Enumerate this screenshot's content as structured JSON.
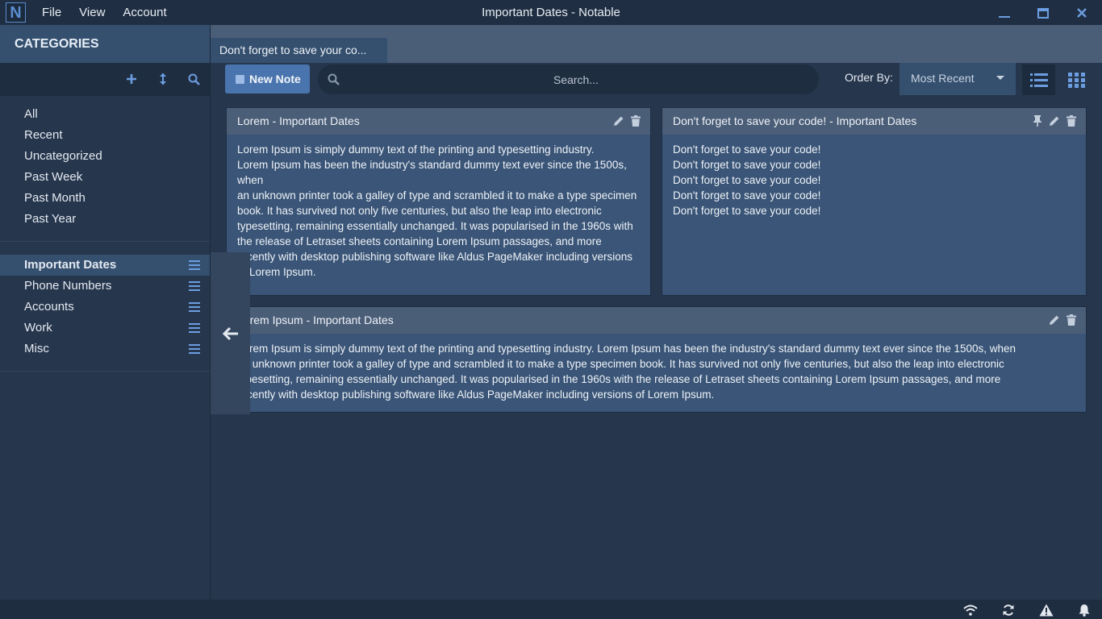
{
  "app": {
    "window_title": "Important Dates - Notable",
    "logo_letter": "N",
    "menu": [
      "File",
      "View",
      "Account"
    ]
  },
  "sidebar": {
    "header": "CATEGORIES",
    "filters": [
      "All",
      "Recent",
      "Uncategorized",
      "Past Week",
      "Past Month",
      "Past Year"
    ],
    "categories": [
      "Important Dates",
      "Phone Numbers",
      "Accounts",
      "Work",
      "Misc"
    ],
    "active_category": "Important Dates"
  },
  "tab": {
    "label": "Don't forget to save your co..."
  },
  "toolbar": {
    "new_note_label": "New Note",
    "search_placeholder": "Search...",
    "order_label": "Order By:",
    "order_value": "Most Recent"
  },
  "notes": [
    {
      "title": "Lorem  -  Important Dates",
      "lines": [
        "Lorem Ipsum is simply dummy text of the printing and typesetting industry.",
        "Lorem Ipsum has been the industry's standard dummy text ever since the 1500s, when",
        "an unknown printer took a galley of type and scrambled it to make a type specimen book. It has survived not only five centuries, but also the leap into electronic",
        "typesetting, remaining essentially unchanged. It was popularised in the 1960s with the release of Letraset sheets containing Lorem Ipsum passages, and more recently with desktop publishing software like Aldus PageMaker including versions of Lorem Ipsum."
      ]
    },
    {
      "title": "Don't forget to save your code!  -  Important Dates",
      "lines": [
        "Don't forget to save your code!",
        "Don't forget to save your code!",
        "Don't forget to save your code!",
        "Don't forget to save your code!",
        "Don't forget to save your code!"
      ]
    },
    {
      "title": "Lorem Ipsum  -  Important Dates",
      "lines": [
        "Lorem Ipsum is simply dummy text of the printing and typesetting industry. Lorem Ipsum has been the industry's standard dummy text ever since the 1500s, when",
        "an unknown printer took a galley of type and scrambled it to make a type specimen book. It has survived not only five centuries, but also the leap into electronic",
        "typesetting, remaining essentially unchanged. It was popularised in the 1960s with the release of Letraset sheets containing Lorem Ipsum passages, and more",
        "recently with desktop publishing software like Aldus PageMaker including versions of Lorem Ipsum."
      ]
    }
  ],
  "icons": {
    "accent": "#6b9de0",
    "status_icons": [
      "wifi-icon",
      "sync-icon",
      "warning-icon",
      "bell-icon"
    ]
  }
}
